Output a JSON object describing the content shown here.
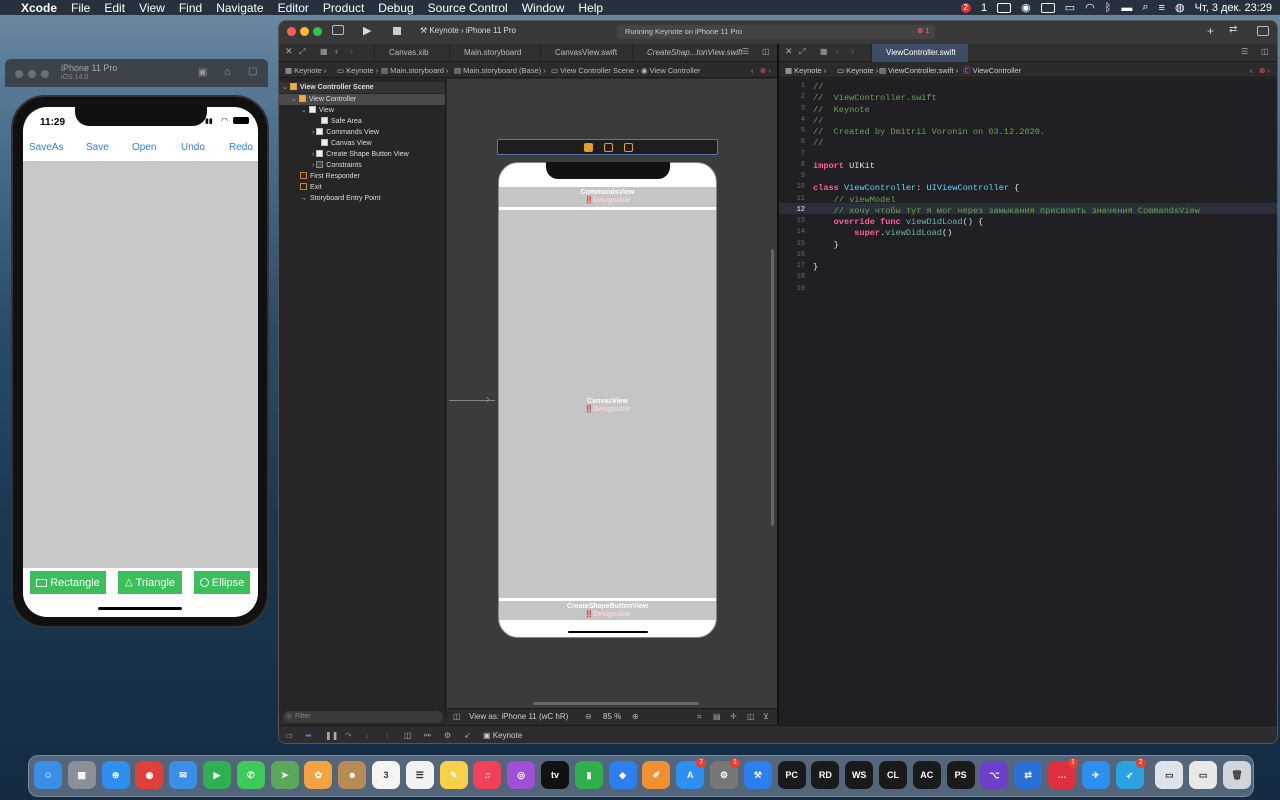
{
  "menubar": {
    "apple": "",
    "items": [
      "Xcode",
      "File",
      "Edit",
      "View",
      "Find",
      "Navigate",
      "Editor",
      "Product",
      "Debug",
      "Source Control",
      "Window",
      "Help"
    ],
    "right": {
      "badge_red": "2",
      "notif": "1",
      "clock": "Чт, 3 дек.  23:29"
    }
  },
  "simulator": {
    "device": "iPhone 11 Pro",
    "ios": "iOS 14.0",
    "time": "11:29",
    "nav_buttons": [
      "SaveAs",
      "Save",
      "Open",
      "Undo",
      "Redo"
    ],
    "shape_buttons": [
      {
        "icon": "rectangle-icon",
        "label": "Rectangle"
      },
      {
        "icon": "triangle-icon",
        "label": "Triangle"
      },
      {
        "icon": "circle-icon",
        "label": "Ellipse"
      }
    ],
    "canvas_color": "#c8c8c8",
    "button_color": "#3bbf5a"
  },
  "toolbar": {
    "scheme": "Keynote",
    "device": "iPhone 11 Pro",
    "status": "Running Keynote on iPhone 11 Pro",
    "error_count": "1"
  },
  "tabs_left": [
    "Canvas.xib",
    "Main.storyboard",
    "CanvasView.swift",
    "CreateShap...tonView.swift"
  ],
  "tabs_right": [
    "ViewController.swift"
  ],
  "jumpbar_left": [
    "Keynote",
    "Keynote",
    "Main.storyboard",
    "Main.storyboard (Base)",
    "View Controller Scene",
    "View Controller"
  ],
  "jumpbar_right": [
    "Keynote",
    "Keynote",
    "ViewController.swift",
    "ViewController"
  ],
  "outline": {
    "scene": "View Controller Scene",
    "items": [
      {
        "label": "View Controller",
        "indent": 1
      },
      {
        "label": "View",
        "indent": 2
      },
      {
        "label": "Safe Area",
        "indent": 3
      },
      {
        "label": "Commands View",
        "indent": 3
      },
      {
        "label": "Canvas View",
        "indent": 3
      },
      {
        "label": "Create Shape Button View",
        "indent": 3
      },
      {
        "label": "Constraints",
        "indent": 3
      },
      {
        "label": "First Responder",
        "indent": 1
      },
      {
        "label": "Exit",
        "indent": 1
      },
      {
        "label": "Storyboard Entry Point",
        "indent": 1
      }
    ],
    "filter_placeholder": "Filter"
  },
  "ib": {
    "commands_view": "CommandsView",
    "canvas_view": "CanvasView",
    "create_shape_view": "CreateShapeButtonView",
    "designable": "‼️Designable",
    "view_as": "View as: iPhone 11 (wC hR)",
    "zoom": "85 %"
  },
  "code_lines": [
    {
      "n": "1",
      "t": "//"
    },
    {
      "n": "2",
      "t": "//  ViewController.swift"
    },
    {
      "n": "3",
      "t": "//  Keynote"
    },
    {
      "n": "4",
      "t": "//"
    },
    {
      "n": "5",
      "t": "//  Created by Dmitrii Voronin on 03.12.2020."
    },
    {
      "n": "6",
      "t": "//"
    },
    {
      "n": "7",
      "t": ""
    },
    {
      "n": "8",
      "t": "import UIKit"
    },
    {
      "n": "9",
      "t": ""
    },
    {
      "n": "10",
      "t": "class ViewController: UIViewController {"
    },
    {
      "n": "11",
      "t": "    // viewModel"
    },
    {
      "n": "12",
      "t": "    // хочу чтобы тут я мог через замыкания присвоить значения CommandsView"
    },
    {
      "n": "13",
      "t": "    override func viewDidLoad() {"
    },
    {
      "n": "14",
      "t": "        super.viewDidLoad()"
    },
    {
      "n": "15",
      "t": "    }"
    },
    {
      "n": "16",
      "t": ""
    },
    {
      "n": "17",
      "t": "}"
    },
    {
      "n": "18",
      "t": ""
    },
    {
      "n": "19",
      "t": ""
    }
  ],
  "debugbar": {
    "target": "Keynote"
  },
  "dock": {
    "apps": [
      {
        "name": "Finder",
        "glyph": "☺",
        "color": "#3a8ee6"
      },
      {
        "name": "Launchpad",
        "glyph": "▦",
        "color": "#8a8f99"
      },
      {
        "name": "Safari",
        "glyph": "⊕",
        "color": "#2d8ff0"
      },
      {
        "name": "Chrome",
        "glyph": "◉",
        "color": "#e0403a"
      },
      {
        "name": "Mail",
        "glyph": "✉",
        "color": "#3b8fe8"
      },
      {
        "name": "FaceTime",
        "glyph": "▶",
        "color": "#30b050"
      },
      {
        "name": "Messages",
        "glyph": "✆",
        "color": "#3ccb57"
      },
      {
        "name": "Maps",
        "glyph": "➤",
        "color": "#5aa85a"
      },
      {
        "name": "Photos",
        "glyph": "✿",
        "color": "#f4a340"
      },
      {
        "name": "Contacts",
        "glyph": "☻",
        "color": "#b88a55"
      },
      {
        "name": "Calendar",
        "glyph": "3",
        "color": "#f5f5f5"
      },
      {
        "name": "Reminders",
        "glyph": "☰",
        "color": "#f2f2f2"
      },
      {
        "name": "Notes",
        "glyph": "✎",
        "color": "#f5d24a"
      },
      {
        "name": "Music",
        "glyph": "♫",
        "color": "#f0405a"
      },
      {
        "name": "Podcasts",
        "glyph": "◎",
        "color": "#a04fd8"
      },
      {
        "name": "TV",
        "glyph": "tv",
        "color": "#111111"
      },
      {
        "name": "Numbers",
        "glyph": "▮",
        "color": "#2fb04a"
      },
      {
        "name": "Keynote",
        "glyph": "◆",
        "color": "#2d7ff0"
      },
      {
        "name": "Pages",
        "glyph": "✐",
        "color": "#f09030"
      },
      {
        "name": "App Store",
        "glyph": "A",
        "color": "#2d8ff0"
      },
      {
        "name": "System Preferences",
        "glyph": "⚙",
        "color": "#777777"
      },
      {
        "name": "Xcode",
        "glyph": "⚒",
        "color": "#2d7ff0"
      },
      {
        "name": "PyCharm",
        "glyph": "PC",
        "color": "#1a1a1a"
      },
      {
        "name": "Rider",
        "glyph": "RD",
        "color": "#1a1a1a"
      },
      {
        "name": "WebStorm",
        "glyph": "WS",
        "color": "#1a1a1a"
      },
      {
        "name": "CLion",
        "glyph": "CL",
        "color": "#1a1a1a"
      },
      {
        "name": "AppCode",
        "glyph": "AC",
        "color": "#1a1a1a"
      },
      {
        "name": "PhpStorm",
        "glyph": "PS",
        "color": "#1a1a1a"
      },
      {
        "name": "GitHub Desktop",
        "glyph": "⌥",
        "color": "#6e40c9"
      },
      {
        "name": "TeamViewer",
        "glyph": "⇄",
        "color": "#2a6fd6"
      },
      {
        "name": "Speech",
        "glyph": "…",
        "color": "#e03040"
      },
      {
        "name": "Instruments",
        "glyph": "✈",
        "color": "#2d8ff0"
      },
      {
        "name": "Telegram",
        "glyph": "➶",
        "color": "#2aa3e0"
      },
      {
        "name": "Preview",
        "glyph": "▭",
        "color": "#dde3ea"
      },
      {
        "name": "Messages2",
        "glyph": "▭",
        "color": "#e8e8e8"
      },
      {
        "name": "Trash",
        "glyph": "🗑",
        "color": "#cfd5db"
      }
    ],
    "badges": [
      {
        "after": "App Store",
        "text": "7"
      },
      {
        "after": "System Preferences",
        "text": "1"
      },
      {
        "after": "Speech",
        "text": "1"
      },
      {
        "after": "Telegram",
        "text": "2"
      }
    ]
  }
}
